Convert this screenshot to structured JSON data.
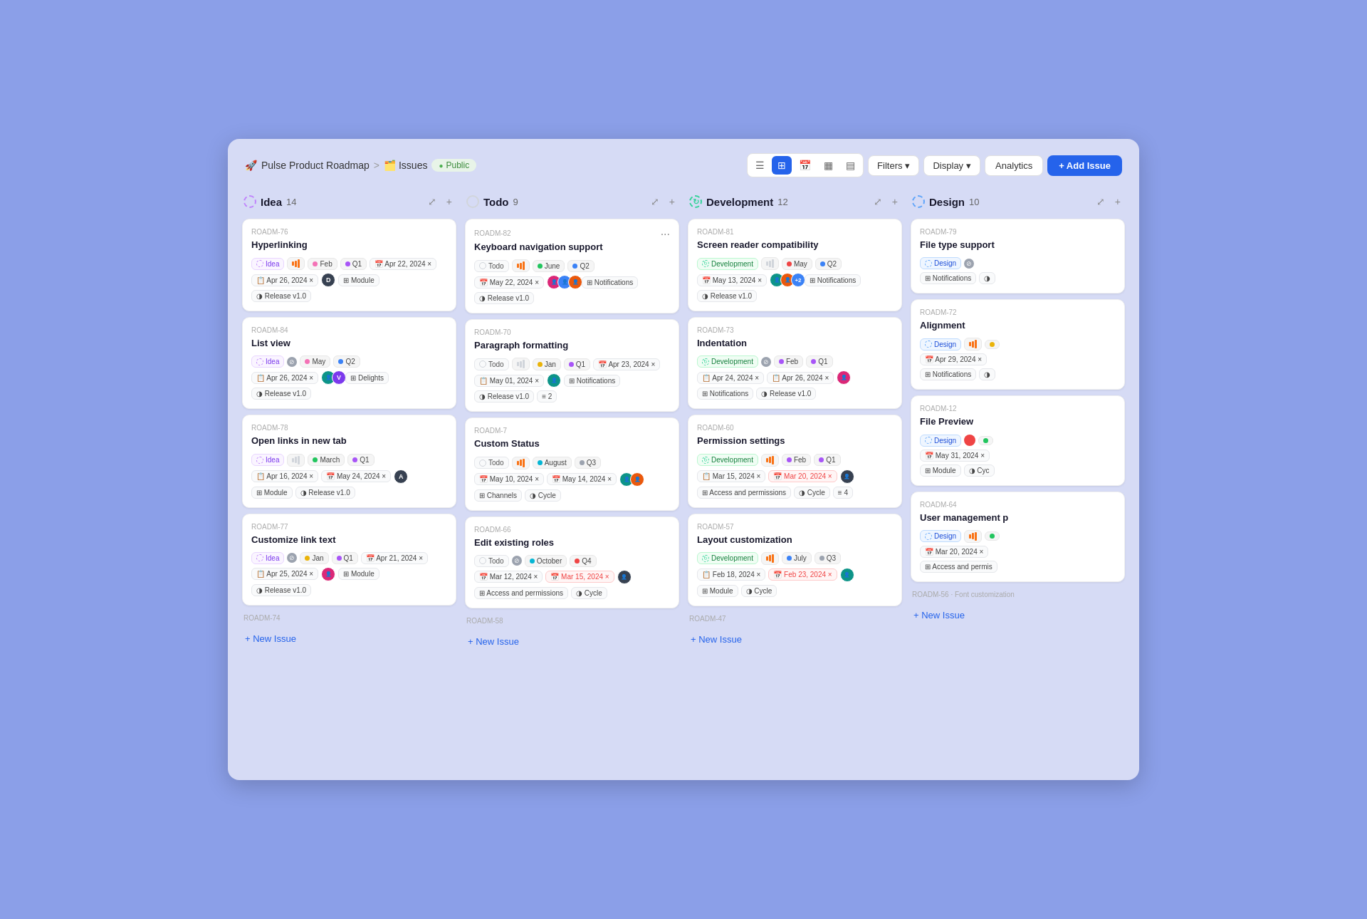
{
  "app": {
    "project_name": "Pulse Product Roadmap",
    "breadcrumb_sep": ">",
    "issues_label": "Issues",
    "public_label": "Public",
    "analytics_label": "Analytics",
    "add_issue_label": "+ Add Issue",
    "filters_label": "Filters",
    "display_label": "Display"
  },
  "columns": [
    {
      "id": "idea",
      "title": "Idea",
      "count": 14,
      "cards": [
        {
          "id": "ROADM-76",
          "title": "Hyperlinking",
          "type": "Idea",
          "priority": "bar",
          "month": "Feb",
          "quarter": "Q1",
          "date1": "Apr 22, 2024",
          "date2": "Apr 26, 2024",
          "assignee": "D",
          "assignee_color": "dark",
          "module": "Module",
          "release": "Release v1.0",
          "month_dot": "pink"
        },
        {
          "id": "ROADM-84",
          "title": "List view",
          "type": "Idea",
          "blocked": true,
          "month": "May",
          "quarter": "Q2",
          "date1": "Apr 26, 2024",
          "assignees": [
            "img1",
            "img2"
          ],
          "module": "Delights",
          "release": "Release v1.0",
          "month_dot": "pink"
        },
        {
          "id": "ROADM-78",
          "title": "Open links in new tab",
          "type": "Idea",
          "priority": "bar2",
          "month": "March",
          "quarter": "Q1",
          "date1": "Apr 16, 2024",
          "date2": "May 24, 2024",
          "assignee": "A",
          "assignee_color": "dark",
          "module": "Module",
          "release": "Release v1.0",
          "month_dot": "green"
        },
        {
          "id": "ROADM-77",
          "title": "Customize link text",
          "type": "Idea",
          "blocked": true,
          "month": "Jan",
          "quarter": "Q1",
          "date1": "Apr 21, 2024",
          "date2": "Apr 25, 2024",
          "assignee_img": true,
          "module": "Module",
          "release": "Release v1.0",
          "month_dot": "yellow"
        },
        {
          "id": "ROADM-74",
          "title": "",
          "is_stub": true
        }
      ]
    },
    {
      "id": "todo",
      "title": "Todo",
      "count": 9,
      "cards": [
        {
          "id": "ROADM-82",
          "title": "Keyboard navigation support",
          "has_more": true,
          "type": "Todo",
          "priority": "bar",
          "month": "June",
          "quarter": "Q2",
          "date1": "May 22, 2024",
          "avatars": [
            "img-a",
            "img-b",
            "img-c"
          ],
          "module": "Notifications",
          "release": "Release v1.0",
          "month_dot": "green"
        },
        {
          "id": "ROADM-70",
          "title": "Paragraph formatting",
          "type": "Todo",
          "priority": "bar2",
          "month": "Jan",
          "quarter": "Q1",
          "date1": "Apr 23, 2024",
          "date2": "May 01, 2024",
          "assignee_img": true,
          "module": "Notifications",
          "release": "Release v1.0",
          "layers": "2",
          "month_dot": "yellow"
        },
        {
          "id": "ROADM-7",
          "title": "Custom Status",
          "type": "Todo",
          "priority": "bar",
          "month": "August",
          "quarter": "Q3",
          "date1": "May 10, 2024",
          "date2": "May 14, 2024",
          "avatars2": [
            "img-d",
            "img-e"
          ],
          "module": "Channels",
          "release": "Cycle",
          "month_dot": "cyan"
        },
        {
          "id": "ROADM-66",
          "title": "Edit existing roles",
          "type": "Todo",
          "blocked": true,
          "month": "October",
          "quarter": "Q4",
          "date1": "Mar 12, 2024",
          "date2_overdue": "Mar 15, 2024",
          "assignee_img": true,
          "module": "Access and permissions",
          "release": "Cycle",
          "month_dot": "cyan"
        },
        {
          "id": "ROADM-58",
          "title": "",
          "is_stub": true
        }
      ]
    },
    {
      "id": "development",
      "title": "Development",
      "count": 12,
      "cards": [
        {
          "id": "ROADM-81",
          "title": "Screen reader compatibility",
          "type": "Development",
          "priority": "bar2",
          "month": "May",
          "quarter": "Q2",
          "date1": "May 13, 2024",
          "avatars_plus": "+2",
          "module": "Notifications",
          "release": "Release v1.0",
          "month_dot": "red"
        },
        {
          "id": "ROADM-73",
          "title": "Indentation",
          "type": "Development",
          "blocked": true,
          "month": "Feb",
          "quarter": "Q1",
          "date1": "Apr 24, 2024",
          "date2": "Apr 26, 2024",
          "assignee_img": true,
          "module": "Notifications",
          "release": "Release v1.0",
          "month_dot": "purple"
        },
        {
          "id": "ROADM-60",
          "title": "Permission settings",
          "type": "Development",
          "priority": "bar",
          "month": "Feb",
          "quarter": "Q1",
          "date1": "Mar 15, 2024",
          "date2_overdue": "Mar 20, 2024",
          "assignee_img2": true,
          "module": "Access and permissions",
          "release": "Cycle",
          "layers": "4",
          "month_dot": "purple"
        },
        {
          "id": "ROADM-57",
          "title": "Layout customization",
          "type": "Development",
          "priority": "bar",
          "month": "July",
          "quarter": "Q3",
          "date1": "Feb 18, 2024",
          "date2_overdue": "Feb 23, 2024",
          "assignee_img": true,
          "module": "Module",
          "release": "Cycle",
          "month_dot": "blue"
        },
        {
          "id": "ROADM-47",
          "title": "",
          "is_stub": true
        }
      ]
    },
    {
      "id": "design",
      "title": "Design",
      "count": 10,
      "cards": [
        {
          "id": "ROADM-79",
          "title": "File type support",
          "type": "Design",
          "blocked_small": true,
          "module": "Notifications"
        },
        {
          "id": "ROADM-72",
          "title": "Alignment",
          "type": "Design",
          "priority": "bar",
          "month_dot": "yellow",
          "date1": "Apr 29, 2024",
          "module": "Notifications"
        },
        {
          "id": "ROADM-12",
          "title": "File Preview",
          "type": "Design",
          "circle_red": true,
          "month_dot": "green",
          "date1": "May 31, 2024",
          "module": "Module",
          "release": "Cyc"
        },
        {
          "id": "ROADM-64",
          "title": "User management p",
          "type": "Design",
          "priority": "bar",
          "month_dot": "green",
          "date1": "Mar 20, 2024",
          "module": "Access and permis"
        },
        {
          "id": "ROADM-56",
          "title": "Font customization",
          "is_stub": true
        }
      ]
    }
  ],
  "new_issue_label": "+ New Issue"
}
